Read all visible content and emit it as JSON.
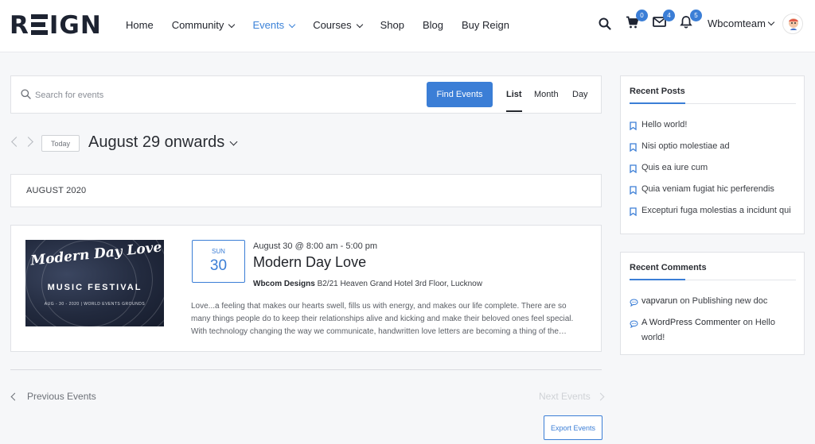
{
  "brand": {
    "logo_text_left": "R",
    "logo_text_right": "IGN"
  },
  "nav": {
    "items": [
      {
        "label": "Home",
        "dropdown": false,
        "active": false
      },
      {
        "label": "Community",
        "dropdown": true,
        "active": false
      },
      {
        "label": "Events",
        "dropdown": true,
        "active": true
      },
      {
        "label": "Courses",
        "dropdown": true,
        "active": false
      },
      {
        "label": "Shop",
        "dropdown": false,
        "active": false
      },
      {
        "label": "Blog",
        "dropdown": false,
        "active": false
      },
      {
        "label": "Buy Reign",
        "dropdown": false,
        "active": false
      }
    ]
  },
  "header_icons": {
    "search": "search-icon",
    "cart": {
      "icon": "cart-icon",
      "count": "0"
    },
    "messages": {
      "icon": "envelope-icon",
      "count": "4"
    },
    "notifications": {
      "icon": "bell-icon",
      "count": "5"
    }
  },
  "user": {
    "name": "Wbcomteam"
  },
  "events_bar": {
    "search_placeholder": "Search for events",
    "find_button": "Find Events",
    "views": [
      "List",
      "Month",
      "Day"
    ],
    "active_view": "List"
  },
  "date_nav": {
    "today_label": "Today",
    "range_title": "August 29 onwards"
  },
  "month_separator": "AUGUST 2020",
  "event": {
    "image_title": "Modern Day Love",
    "image_subtitle": "MUSIC FESTIVAL",
    "image_footer": "AUG - 30 - 2020 | WORLD EVENTS GROUNDS",
    "day_of_week": "SUN",
    "day_number": "30",
    "datetime": "August 30 @ 8:00 am - 5:00 pm",
    "title": "Modern Day Love",
    "venue_name": "Wbcom Designs",
    "venue_address": "B2/21 Heaven Grand Hotel 3rd Floor, Lucknow",
    "description": "Love...a feeling that makes our hearts swell, fills us with energy, and makes our life complete. There are so many things people do to keep their relationships alive and kicking and make their beloved ones feel special. With technology changing the way we communicate, handwritten love letters are becoming a thing of the…"
  },
  "pagination": {
    "previous": "Previous Events",
    "next": "Next Events"
  },
  "export_button": "Export Events",
  "recent_posts": {
    "title": "Recent Posts",
    "items": [
      "Hello world!",
      "Nisi optio molestiae ad",
      "Quis ea iure cum",
      "Quia veniam fugiat hic perferendis",
      "Excepturi fuga molestias a incidunt qui"
    ]
  },
  "recent_comments": {
    "title": "Recent Comments",
    "items": [
      {
        "author": "vapvarun",
        "connector": " on ",
        "post": "Publishing new doc"
      },
      {
        "author": "A WordPress Commenter",
        "connector": " on ",
        "post": "Hello world!"
      }
    ]
  },
  "colors": {
    "accent": "#3b7ed6",
    "text_dark": "#1d2331",
    "page_bg": "#f6f7f9"
  }
}
